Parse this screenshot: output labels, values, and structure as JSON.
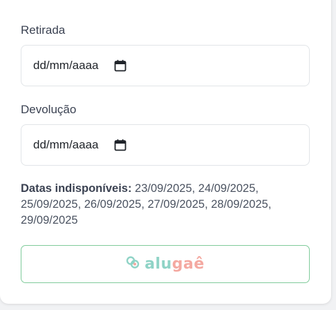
{
  "pickup": {
    "label": "Retirada",
    "placeholder": "dd/mm/aaaa"
  },
  "return": {
    "label": "Devolução",
    "placeholder": "dd/mm/aaaa"
  },
  "unavailable": {
    "label": "Datas indisponíveis:",
    "dates_line1": " 23/09/2025, 24/09/2025,",
    "dates_line2": "25/09/2025, 26/09/2025, 27/09/2025, 28/09/2025,",
    "dates_line3": "29/09/2025"
  },
  "brand": {
    "part1": "alu",
    "part2": "gaê",
    "colors": {
      "teal": "#8fd3c6",
      "coral": "#f4a9a1",
      "border": "#7fcb9a"
    }
  }
}
